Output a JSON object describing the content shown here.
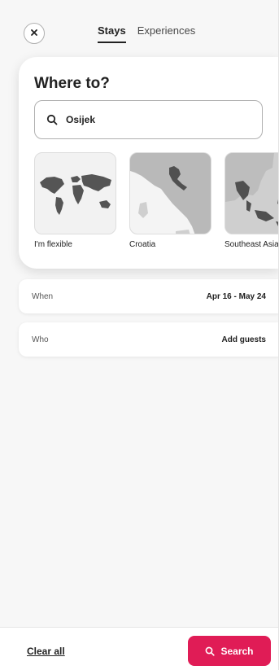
{
  "header": {
    "close_icon": "close-icon",
    "tabs": [
      {
        "label": "Stays",
        "active": true
      },
      {
        "label": "Experiences",
        "active": false
      }
    ]
  },
  "where": {
    "title": "Where to?",
    "search": {
      "value": "Osijek",
      "icon": "search-icon"
    },
    "regions": [
      {
        "label": "I'm flexible"
      },
      {
        "label": "Croatia"
      },
      {
        "label": "Southeast Asia"
      }
    ]
  },
  "when": {
    "label": "When",
    "value": "Apr 16 - May 24"
  },
  "who": {
    "label": "Who",
    "value": "Add guests"
  },
  "footer": {
    "clear_label": "Clear all",
    "search_label": "Search",
    "search_color": "#e01c56"
  }
}
